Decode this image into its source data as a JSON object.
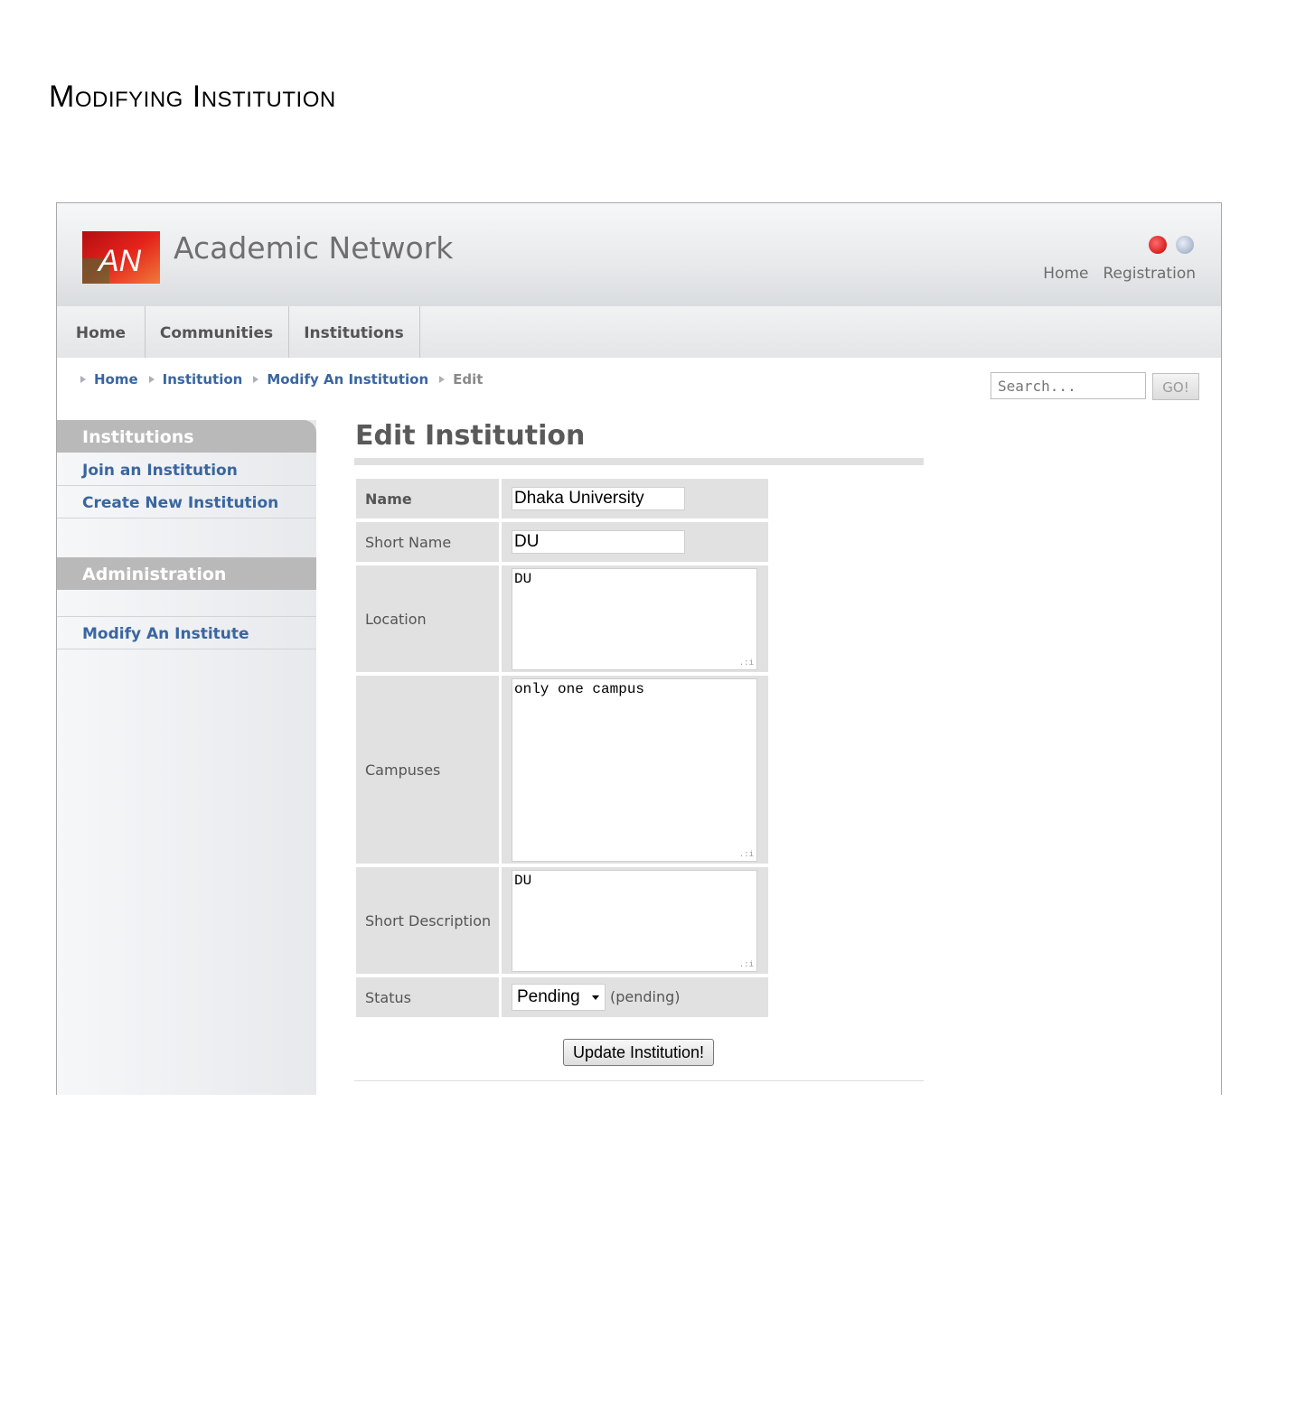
{
  "doc_heading": "Modifying Institution",
  "site": {
    "logo_text": "AN",
    "title": "Academic Network",
    "top_links": [
      "Home",
      "Registration"
    ],
    "icons": [
      "power-icon",
      "user-icon"
    ]
  },
  "nav": {
    "tabs": [
      "Home",
      "Communities",
      "Institutions"
    ]
  },
  "breadcrumb": [
    "Home",
    "Institution",
    "Modify An Institution",
    "Edit"
  ],
  "search": {
    "placeholder": "Search...",
    "button": "GO!"
  },
  "sidebar": {
    "section1": "Institutions",
    "section1_items": [
      "Join an Institution",
      "Create New Institution"
    ],
    "section2": "Administration",
    "section2_items": [
      "Modify An Institute"
    ]
  },
  "form": {
    "title": "Edit Institution",
    "name_label": "Name",
    "name_value": "Dhaka University",
    "short_name_label": "Short Name",
    "short_name_value": "DU",
    "location_label": "Location",
    "location_value": "DU",
    "campuses_label": "Campuses",
    "campuses_value": "only one campus",
    "short_desc_label": "Short Description",
    "short_desc_value": "DU",
    "status_label": "Status",
    "status_value": "Pending",
    "status_note": "(pending)",
    "submit": "Update Institution!"
  },
  "colors": {
    "link": "#3a66a0",
    "logo_red": "#d8141c",
    "sidebar_head": "#b9b9b9"
  }
}
